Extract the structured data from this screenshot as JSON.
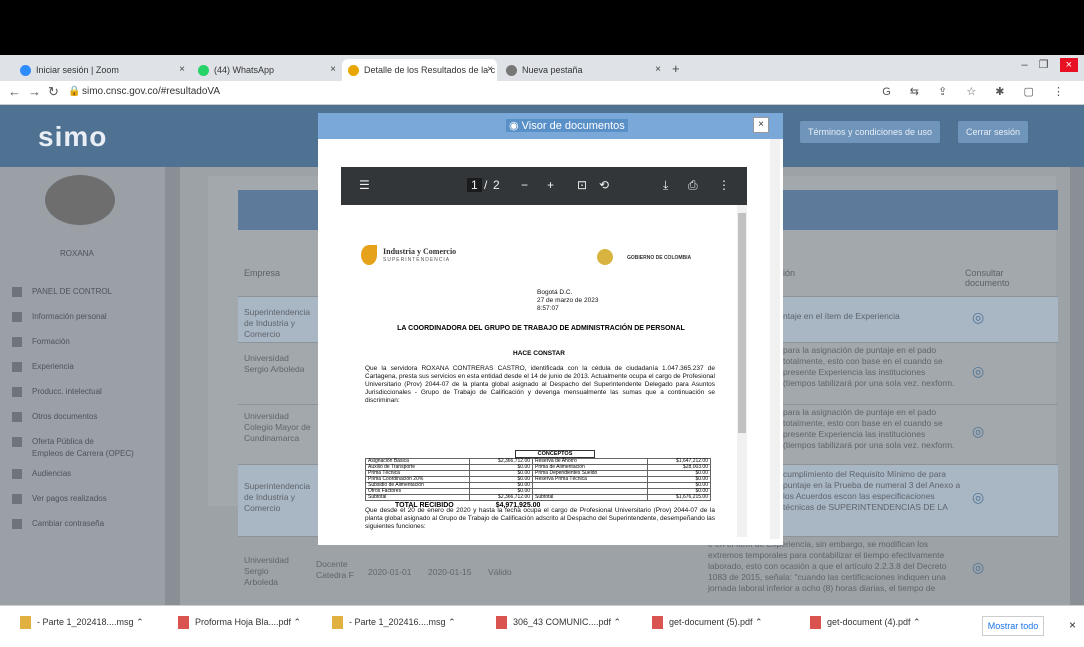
{
  "browser": {
    "tabs": [
      {
        "label": "Iniciar sesión | Zoom",
        "icon_color": "#2d8cff"
      },
      {
        "label": "(44) WhatsApp",
        "icon_color": "#25d366"
      },
      {
        "label": "Detalle de los Resultados de la c",
        "icon_color": "#e8a600"
      },
      {
        "label": "Nueva pestaña",
        "icon_color": "#777777"
      }
    ],
    "new_tab": "+",
    "url": "simo.cnsc.gov.co/#resultadoVA"
  },
  "header": {
    "logo": "simo",
    "terms_button": "Términos y condiciones de uso",
    "logout_button": "Cerrar sesión"
  },
  "sidebar": {
    "user_name": "ROXANA",
    "items": [
      {
        "label": "PANEL DE CONTROL"
      },
      {
        "label": "Información personal"
      },
      {
        "label": "Formación"
      },
      {
        "label": "Experiencia"
      },
      {
        "label": "Producc. intelectual"
      },
      {
        "label": "Otros documentos"
      },
      {
        "label": "Oferta Pública de"
      },
      {
        "label": "Empleos de Carrera (OPEC)"
      },
      {
        "label": "Audiencias"
      },
      {
        "label": "Ver pagos realizados"
      },
      {
        "label": "Cambiar contraseña"
      }
    ]
  },
  "table": {
    "headers": [
      "Empresa",
      "ión",
      "Consultar documento"
    ],
    "rows": [
      {
        "empresa": "Superintendencia de Industria y Comercio",
        "obs": "ntaje en el ítem de Experiencia"
      },
      {
        "empresa": "Universidad Sergio Arboleda",
        "obs": "para la asignación de puntaje en el pado totalmente, esto con base en el cuando se presente Experiencia las instituciones (tiempos tabilizará por una sola vez. nexform."
      },
      {
        "empresa": "Universidad Colegio Mayor de Cundinamarca",
        "obs": "para la asignación de puntaje en el pado totalmente, esto con base en el cuando se presente Experiencia las instituciones (tiempos tabilizará por una sola vez. nexform."
      },
      {
        "empresa": "Superintendencia de Industria y Comercio",
        "obs": "cumplimiento del Requisito Mínimo de para puntaje en la Prueba de numeral 3 del Anexo a los Acuerdos escon las especificaciones técnicas de SUPERINTENDENCIAS DE LA"
      },
      {
        "empresa": "Universidad Sergio Arboleda",
        "cargo": "Docente Catedra F",
        "inicio": "2020-01-01",
        "fin": "2020-01-15",
        "estado": "Válido",
        "obs": "e en el ítem de Experiencia, sin embargo, se modifican los extremos temporales para contabilizar el tiempo efectivamente laborado, esto con ocasión a que el artículo 2.2.3.8 del Decreto 1083 de 2015, señala: \"cuando las certificaciones indiquen una jornada laboral inferior a ocho (8) horas diarias, el tiempo de experiencia se establecerá sumando las horas"
      }
    ]
  },
  "modal": {
    "title": "Visor de documentos",
    "close": "×",
    "pdf": {
      "page_current": "1",
      "page_sep": "/",
      "page_total": "2",
      "doc": {
        "org_name": "Industria y Comercio",
        "org_sub": "SUPERINTENDENCIA",
        "gov_label": "GOBIERNO DE COLOMBIA",
        "city": "Bogotá D.C.",
        "date": "27 de marzo de 2023",
        "time": "8:57:07",
        "heading": "LA COORDINADORA DEL GRUPO DE TRABAJO DE ADMINISTRACIÓN DE PERSONAL",
        "subheading": "HACE CONSTAR",
        "body": "Que la servidora ROXANA CONTRERAS CASTRO, identificada con la cédula de ciudadanía 1.047.365.237 de Cartagena, presta sus servicios en esta entidad desde el 14 de junio de 2013. Actualmente ocupa el cargo de Profesional Universitario (Prov) 2044-07 de la planta global asignado al Despacho del Superintendente Delegado para Asuntos Jurisdiccionales - Grupo de Trabajo de Calificación y devenga mensualmente las sumas que a continuación se discriminan:",
        "table_title": "CONCEPTOS",
        "items_left": [
          [
            "Asignación Básica",
            "$2,366,712.00"
          ],
          [
            "Auxilio de Transporte",
            "$0.00"
          ],
          [
            "Prima Técnica",
            "$0.00"
          ],
          [
            "Prima Coordinación 20%",
            "$0.00"
          ],
          [
            "Subsidio de Alimentación",
            "$0.00"
          ],
          [
            "Otros Factores",
            "$0.00"
          ],
          [
            "Subtotal",
            "$2,366,712.00"
          ]
        ],
        "items_right": [
          [
            "Reserva de Ahorro",
            "$1,647,212.00"
          ],
          [
            "Prima de Alimentación",
            "$28,003.00"
          ],
          [
            "Prima Dependientes Sueldo",
            "$0.00"
          ],
          [
            "Reserva Prima Técnica",
            "$0.00"
          ],
          [
            "",
            "$0.00"
          ],
          [
            "",
            "$0.00"
          ],
          [
            "Subtotal",
            "$1,676,215.00"
          ]
        ],
        "total_label": "TOTAL RECIBIDO",
        "total_value": "$4,971,925.00",
        "footer_text": "Que desde el 20 de enero de 2020 y hasta la fecha ocupa el cargo de Profesional Universitario (Prov) 2044-07 de la planta global asignado al Grupo de Trabajo de Calificación adscrito al Despacho del Superintendente, desempeñando las siguientes funciones:"
      }
    }
  },
  "downloads": {
    "items": [
      {
        "label": "- Parte 1_202418....msg"
      },
      {
        "label": "Proforma Hoja Bla....pdf"
      },
      {
        "label": "- Parte 1_202416....msg"
      },
      {
        "label": "306_43 COMUNIC....pdf"
      },
      {
        "label": "get-document (5).pdf"
      },
      {
        "label": "get-document (4).pdf"
      }
    ],
    "show_all": "Mostrar todo"
  }
}
